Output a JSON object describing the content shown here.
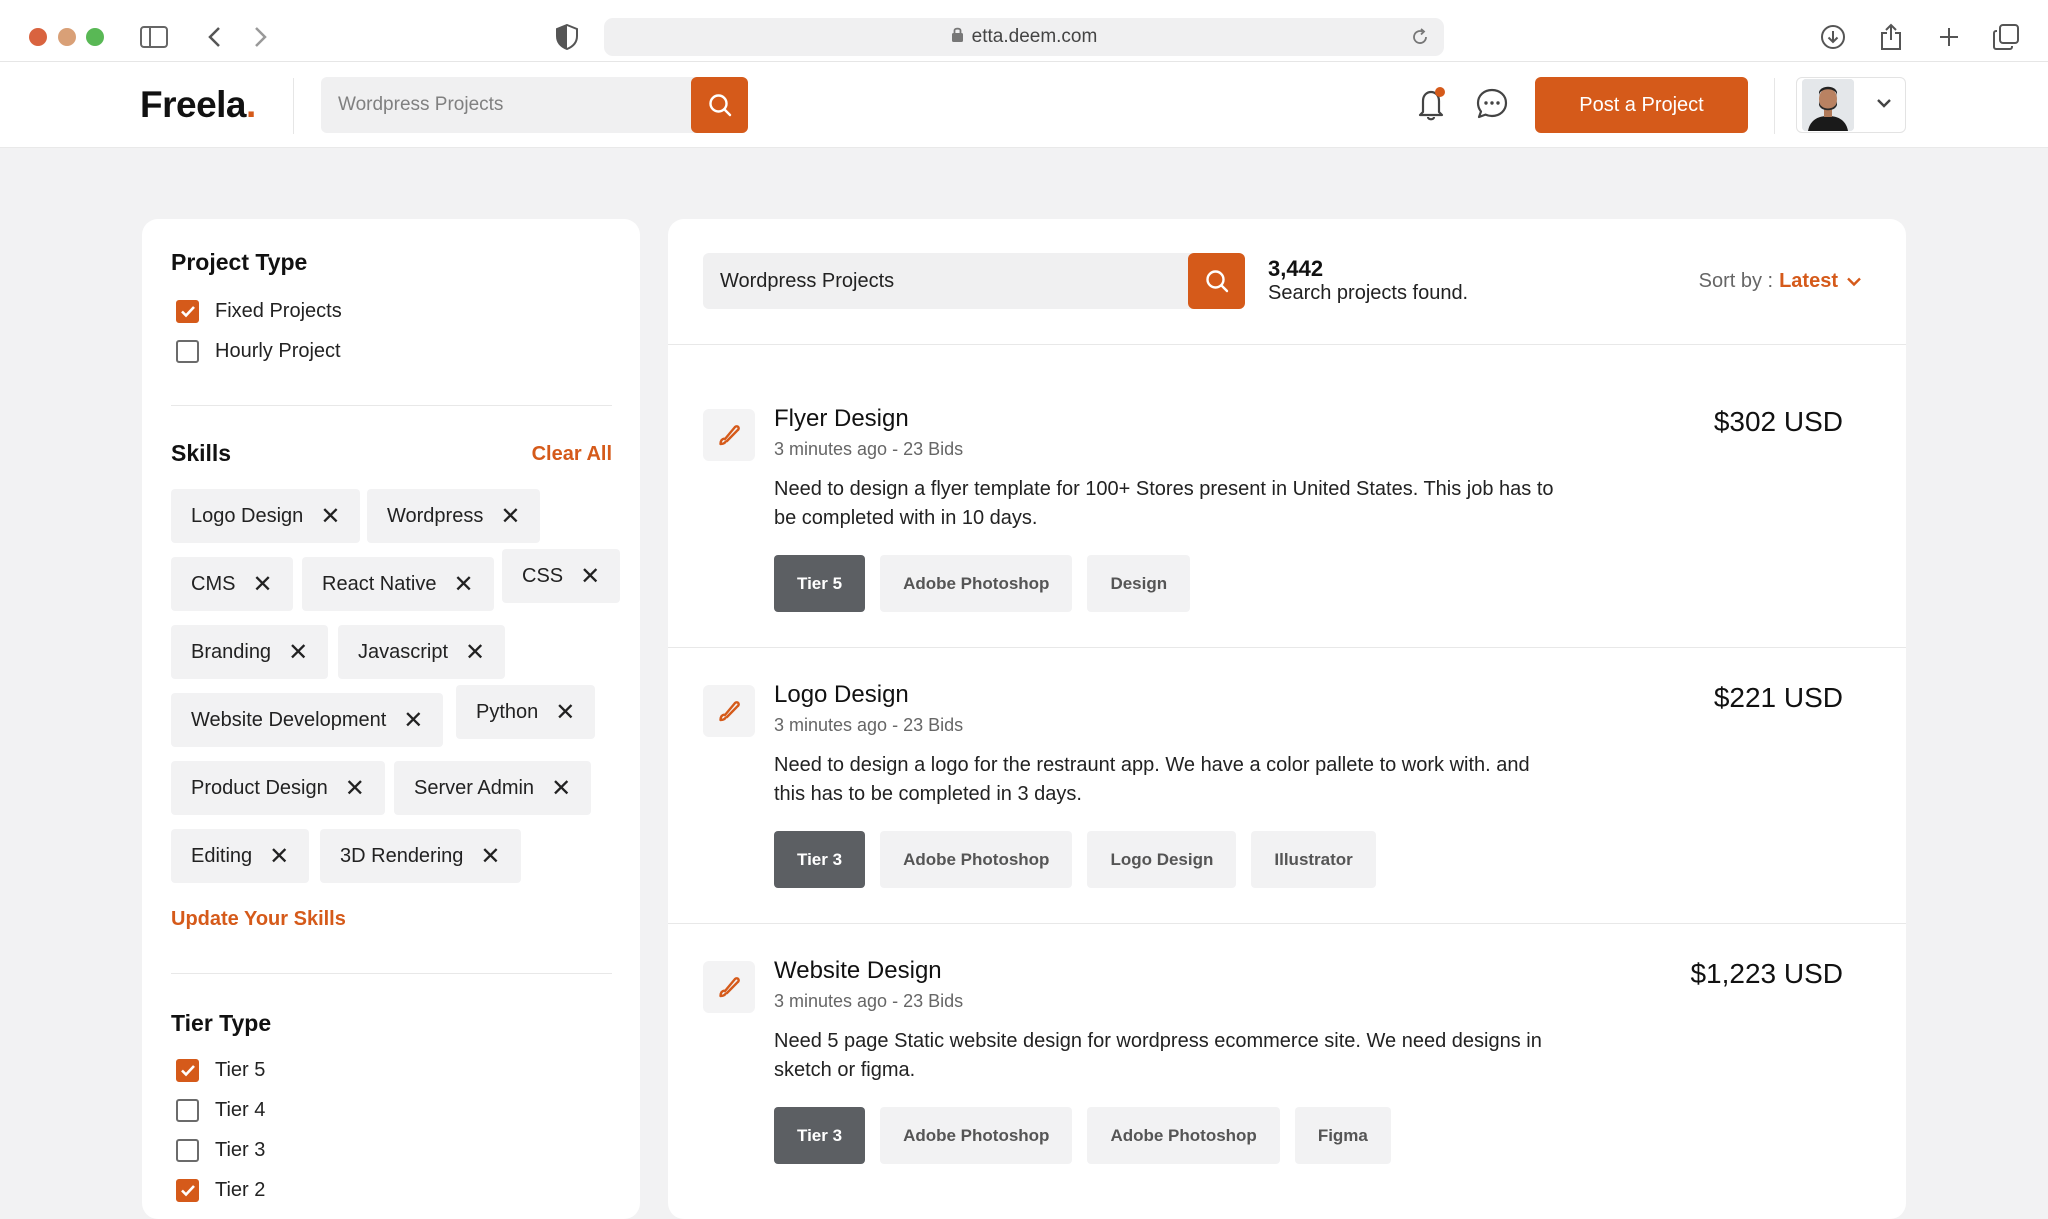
{
  "browser": {
    "url": "etta.deem.com",
    "traffic_colors": [
      "#d9633f",
      "#d9a077",
      "#59b855"
    ]
  },
  "nav": {
    "logo": "Freela",
    "logo_dot": ".",
    "search_placeholder": "Wordpress Projects",
    "post_button": "Post a Project",
    "notification_dot_color": "#d55a1a"
  },
  "sidebar": {
    "project_type": {
      "heading": "Project Type",
      "options": [
        {
          "label": "Fixed Projects",
          "checked": true
        },
        {
          "label": "Hourly Project",
          "checked": false
        }
      ]
    },
    "skills": {
      "heading": "Skills",
      "clear_all": "Clear All",
      "chips": [
        "Logo Design",
        "Wordpress",
        "CMS",
        "React Native",
        "CSS",
        "Branding",
        "Javascript",
        "Website Development",
        "Python",
        "Product Design",
        "Server Admin",
        "Editing",
        "3D Rendering"
      ],
      "update_link": "Update Your Skills"
    },
    "tier_type": {
      "heading": "Tier Type",
      "options": [
        {
          "label": "Tier 5",
          "checked": true
        },
        {
          "label": "Tier 4",
          "checked": false
        },
        {
          "label": "Tier 3",
          "checked": false
        },
        {
          "label": "Tier 2",
          "checked": true
        }
      ]
    }
  },
  "main": {
    "search_value": "Wordpress Projects",
    "result_count": "3,442",
    "result_label": "Search projects found.",
    "sort_label": "Sort by :",
    "sort_value": "Latest",
    "projects": [
      {
        "title": "Flyer Design",
        "meta": "3 minutes ago - 23 Bids",
        "description": "Need to design a flyer template for 100+ Stores present in United States. This job has to be completed with in 10 days.",
        "price": "$302 USD",
        "tier": "Tier 5",
        "tags": [
          "Adobe Photoshop",
          "Design"
        ]
      },
      {
        "title": "Logo Design",
        "meta": "3 minutes ago - 23 Bids",
        "description": "Need to design a logo for the restraunt app. We have a color pallete to work with. and this has to be completed in 3 days.",
        "price": "$221 USD",
        "tier": "Tier 3",
        "tags": [
          "Adobe Photoshop",
          "Logo Design",
          "Illustrator"
        ]
      },
      {
        "title": "Website Design",
        "meta": "3 minutes ago - 23 Bids",
        "description": "Need 5 page Static website design for wordpress ecommerce site. We need designs in sketch or figma.",
        "price": "$1,223 USD",
        "tier": "Tier 3",
        "tags": [
          "Adobe Photoshop",
          "Adobe Photoshop",
          "Figma"
        ]
      }
    ]
  },
  "colors": {
    "accent": "#d55a1a",
    "tier_tag": "#5c5f63"
  }
}
